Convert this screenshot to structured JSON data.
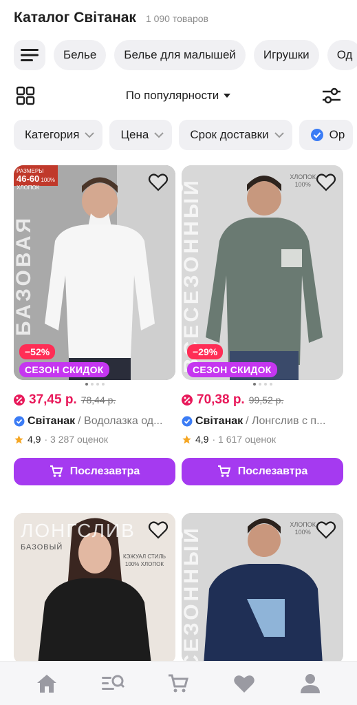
{
  "header": {
    "title": "Каталог Світанак",
    "count": "1 090 товаров"
  },
  "chips": [
    "Белье",
    "Белье для малышей",
    "Игрушки",
    "Од"
  ],
  "sort": {
    "label": "По популярности"
  },
  "filters": [
    "Категория",
    "Цена",
    "Срок доставки",
    "Ор"
  ],
  "products": [
    {
      "side_text": "БАЗОВАЯ",
      "size_badge_top": "РАЗМЕРЫ",
      "size_badge_range": "46-60",
      "size_badge_note": "100% ХЛОПОК",
      "discount": "−52%",
      "season": "СЕЗОН СКИДОК",
      "price": "37,45 р.",
      "old_price": "78,44 р.",
      "seller": "Світанак",
      "product": "/ Водолазка од...",
      "rating": "4,9",
      "reviews": "· 3 287 оценок",
      "buy": "Послезавтра"
    },
    {
      "side_text": "ВСЕСЕЗОННЫЙ",
      "cotton_tag_1": "ХЛОПОК",
      "cotton_tag_2": "100%",
      "discount": "−29%",
      "season": "СЕЗОН СКИДОК",
      "price": "70,38 р.",
      "old_price": "99,52 р.",
      "seller": "Світанак",
      "product": "/ Лонгслив с п...",
      "rating": "4,9",
      "reviews": "· 1 617 оценок",
      "buy": "Послезавтра"
    },
    {
      "side_text": "ЛОНГСЛИВ",
      "sub_text": "БАЗОВЫЙ",
      "style_text": "КЭЖУАЛ СТИЛЬ",
      "style_note": "100% ХЛОПОК"
    },
    {
      "side_text": "ВСЕСЕЗОННЫЙ",
      "cotton_tag_1": "ХЛОПОК",
      "cotton_tag_2": "100%"
    }
  ],
  "tabbar": [
    "home-icon",
    "catalog-search-icon",
    "cart-icon",
    "favorites-icon",
    "profile-icon"
  ],
  "colors": {
    "accent": "#a53af0",
    "price": "#e8195a",
    "discount": "#ff2d55",
    "season": "#c536f0"
  }
}
